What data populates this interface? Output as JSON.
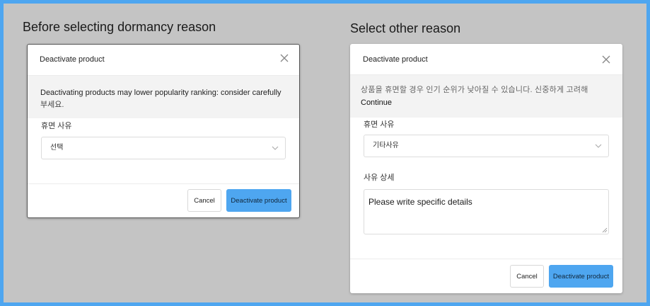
{
  "left": {
    "caption": "Before selecting dormancy reason",
    "modal": {
      "title": "Deactivate product",
      "close": "X",
      "warning": "Deactivating products may lower popularity ranking: consider carefully",
      "warning_overflow": "부세요.",
      "reason_label": "휴면 사유",
      "reason_value": "선택",
      "cancel": "Cancel",
      "confirm": "Deactivate product"
    }
  },
  "right": {
    "caption": "Select other reason",
    "modal": {
      "title": "Deactivate product",
      "close": "X",
      "warning": "상품을 휴면할 경우 인기 순위가 낮아질 수 있습니다. 신중하게 고려해",
      "warning_tail": "Continue",
      "reason_label": "휴면 사유",
      "reason_value": "기타사유",
      "detail_label": "사유 상세",
      "detail_value": "Please write specific details",
      "cancel": "Cancel",
      "confirm": "Deactivate product"
    }
  },
  "colors": {
    "background": "#c4c4c4",
    "frame": "#4ea6f0",
    "primary_button": "#4ea6f0"
  },
  "icons": {
    "close": "close-icon",
    "dropdown": "chevron-down-icon"
  }
}
